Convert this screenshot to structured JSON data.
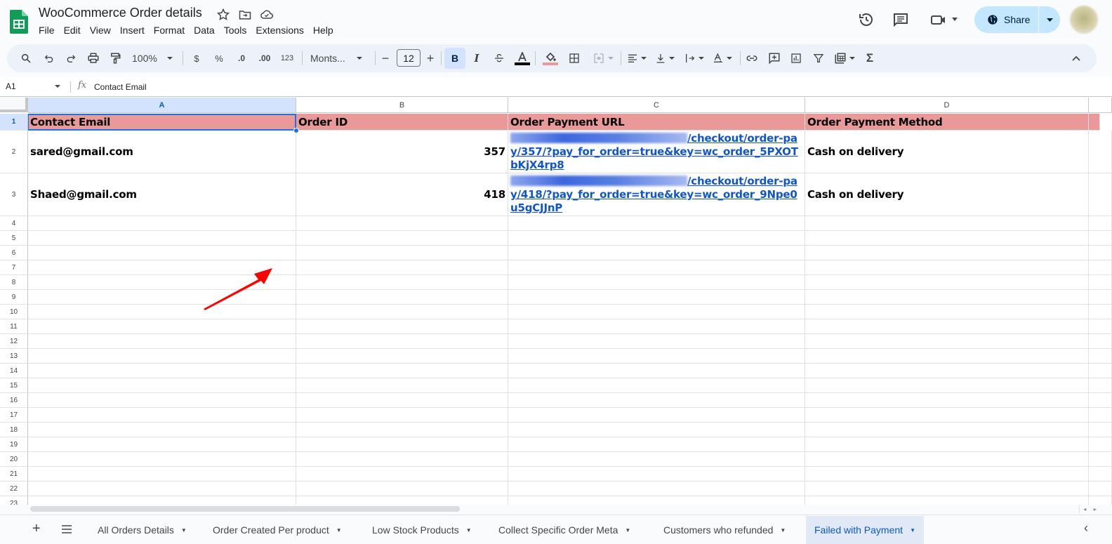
{
  "app": {
    "title": "WooCommerce Order details",
    "menu": [
      "File",
      "Edit",
      "View",
      "Insert",
      "Format",
      "Data",
      "Tools",
      "Extensions",
      "Help"
    ],
    "share_label": "Share",
    "accent_color": "#c2e7ff"
  },
  "toolbar": {
    "zoom": "100%",
    "currency": "$",
    "percent": "%",
    "decrease_decimal": ".0",
    "increase_decimal": ".00",
    "number_format": "123",
    "font": "Monts...",
    "font_size": "12",
    "minus": "−",
    "plus": "+",
    "bold": "B",
    "italic": "I",
    "text_color": "#000000",
    "fill_color": "#ea9999"
  },
  "formula_bar": {
    "cell_ref": "A1",
    "fx": "fx",
    "value": "Contact Email"
  },
  "grid": {
    "columns": [
      "A",
      "B",
      "C",
      "D"
    ],
    "rows": [
      "1",
      "2",
      "3",
      "4",
      "5",
      "6",
      "7",
      "8",
      "9",
      "10",
      "11",
      "12",
      "13",
      "14",
      "15",
      "16",
      "17",
      "18",
      "19",
      "20",
      "21",
      "22",
      "23"
    ],
    "header_fill": "#ea9999",
    "headers": [
      "Contact Email",
      "Order ID",
      "Order Payment URL",
      "Order Payment Method"
    ],
    "data": [
      {
        "email": "sared@gmail.com",
        "order_id": "357",
        "url_visible": "/checkout/order-pay/357/?pay_for_order=true&key=wc_order_5PXOTbKjX4rp8",
        "payment_method": "Cash on delivery"
      },
      {
        "email": "Shaed@gmail.com",
        "order_id": "418",
        "url_visible": "/checkout/order-pay/418/?pay_for_order=true&key=wc_order_9Npe0u5gCJJnP",
        "payment_method": "Cash on delivery"
      }
    ],
    "selected_cell": "A1"
  },
  "sheets": {
    "add": "+",
    "tabs": [
      {
        "label": "All Orders Details",
        "active": false
      },
      {
        "label": "Order Created Per product",
        "active": false
      },
      {
        "label": "Low Stock Products",
        "active": false
      },
      {
        "label": "Collect Specific Order Meta",
        "active": false
      },
      {
        "label": "Customers who refunded",
        "active": false
      },
      {
        "label": "Failed with Payment",
        "active": true
      }
    ]
  },
  "annotation": {
    "type": "red-arrow",
    "color": "#ff0000"
  }
}
